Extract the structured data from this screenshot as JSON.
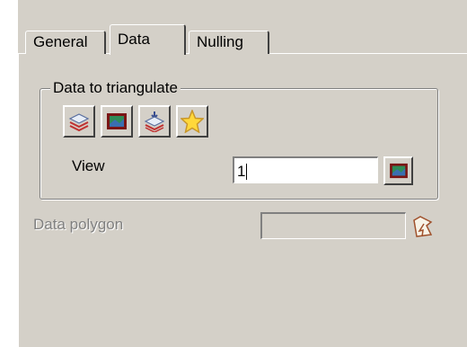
{
  "tabs": [
    {
      "label": "General",
      "active": false
    },
    {
      "label": "Data",
      "active": true
    },
    {
      "label": "Nulling",
      "active": false
    }
  ],
  "group": {
    "title": "Data to triangulate",
    "toolbar": [
      {
        "icon": "layers-icon"
      },
      {
        "icon": "model-icon"
      },
      {
        "icon": "layers-add-icon"
      },
      {
        "icon": "star-icon"
      }
    ]
  },
  "view": {
    "label": "View",
    "value": "1",
    "button_icon": "model-icon"
  },
  "data_polygon": {
    "label": "Data polygon",
    "value": "",
    "enabled": false,
    "button_icon": "polygon-pick-icon"
  }
}
